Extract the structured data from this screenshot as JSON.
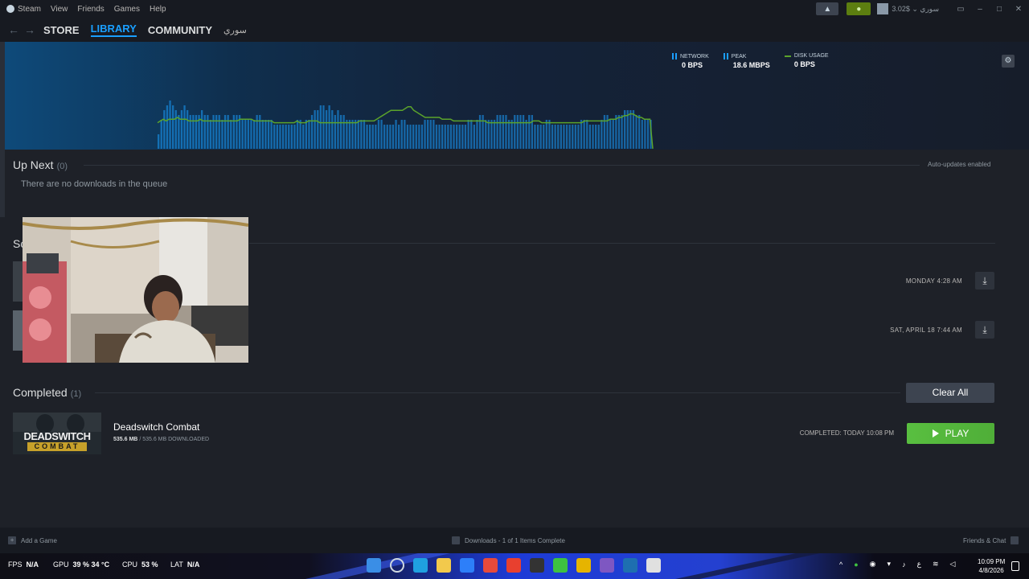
{
  "titlebar": {
    "menu": [
      "Steam",
      "View",
      "Friends",
      "Games",
      "Help"
    ],
    "account_name": "سوري",
    "balance": "$3.02"
  },
  "nav": {
    "store": "STORE",
    "library": "LIBRARY",
    "community": "COMMUNITY",
    "username": "سوري"
  },
  "graph": {
    "stats": [
      {
        "label": "NETWORK",
        "value": "0 bps"
      },
      {
        "label": "PEAK",
        "value": "18.6 Mbps"
      },
      {
        "label": "DISK USAGE",
        "value": "0 bps"
      }
    ],
    "network_bars": [
      3,
      6,
      8,
      9,
      10,
      9,
      8,
      7,
      8,
      9,
      8,
      7,
      7,
      7,
      7,
      8,
      7,
      7,
      6,
      7,
      7,
      7,
      6,
      7,
      7,
      6,
      7,
      7,
      7,
      6,
      6,
      6,
      6,
      6,
      7,
      7,
      6,
      6,
      6,
      6,
      5,
      5,
      5,
      5,
      5,
      5,
      5,
      5,
      6,
      6,
      5,
      6,
      6,
      7,
      8,
      8,
      9,
      9,
      8,
      9,
      8,
      7,
      8,
      7,
      7,
      6,
      6,
      6,
      6,
      6,
      6,
      6,
      5,
      5,
      5,
      5,
      6,
      6,
      5,
      5,
      5,
      5,
      6,
      5,
      6,
      6,
      5,
      5,
      5,
      5,
      5,
      5,
      6,
      6,
      6,
      6,
      5,
      5,
      5,
      5,
      5,
      5,
      5,
      5,
      5,
      5,
      5,
      6,
      6,
      5,
      6,
      7,
      7,
      6,
      6,
      6,
      6,
      7,
      7,
      7,
      7,
      6,
      6,
      7,
      7,
      7,
      7,
      6,
      7,
      7,
      5,
      5,
      5,
      5,
      6,
      6,
      5,
      5,
      5,
      5,
      5,
      5,
      5,
      5,
      5,
      5,
      6,
      6,
      6,
      5,
      5,
      5,
      5,
      6,
      7,
      7,
      6,
      6,
      7,
      7,
      7,
      8,
      8,
      8,
      8,
      7,
      7,
      6,
      6,
      6,
      6
    ],
    "disk_line": [
      2,
      3,
      4,
      3,
      4,
      4,
      4,
      5,
      4,
      4,
      4,
      3,
      3,
      3,
      3,
      4,
      3,
      3,
      3,
      3,
      3,
      3,
      3,
      3,
      3,
      3,
      3,
      3,
      3,
      4,
      4,
      4,
      4,
      4,
      3,
      3,
      3,
      3,
      3,
      3,
      3,
      2,
      2,
      2,
      2,
      2,
      2,
      2,
      2,
      3,
      2,
      2,
      2,
      3,
      3,
      3,
      3,
      2,
      2,
      2,
      2,
      2,
      2,
      2,
      2,
      2,
      2,
      2,
      2,
      2,
      2,
      3,
      3,
      3,
      3,
      3,
      3,
      4,
      5,
      6,
      7,
      8,
      9,
      9,
      9,
      9,
      9,
      10,
      11,
      11,
      9,
      8,
      7,
      6,
      5,
      5,
      5,
      5,
      5,
      5,
      4,
      4,
      4,
      4,
      3,
      3,
      3,
      3,
      3,
      3,
      3,
      3,
      3,
      3,
      3,
      3,
      2,
      2,
      2,
      2,
      2,
      2,
      2,
      2,
      2,
      2,
      2,
      2,
      2,
      2,
      2,
      2,
      3,
      3,
      3,
      2,
      2,
      2,
      2,
      2,
      2,
      2,
      2,
      2,
      2,
      2,
      2,
      2,
      2,
      2,
      3,
      3,
      3,
      3,
      3,
      3,
      3,
      3,
      3,
      4,
      4,
      4,
      5,
      5,
      6,
      6,
      7,
      7,
      6,
      5,
      5,
      4,
      4,
      4,
      0
    ],
    "colors": {
      "network": "#1a9fff",
      "disk": "#5ba32b"
    }
  },
  "up_next": {
    "title": "Up Next",
    "count": "(0)",
    "auto_updates": "Auto-updates enabled",
    "empty_text": "There are no downloads in the queue"
  },
  "scheduled": {
    "title_fragment": "Sc",
    "rows": [
      {
        "time": "MONDAY 4:28 AM"
      },
      {
        "time": "SAT, APRIL 18 7:44 AM"
      }
    ]
  },
  "completed": {
    "title": "Completed",
    "count": "(1)",
    "clear_all": "Clear All",
    "game": {
      "name": "Deadswitch Combat",
      "capsule_line1": "DEADSWITCH",
      "capsule_line2": "COMBAT",
      "size_done": "535.6 MB",
      "size_total": "/ 535.6 MB DOWNLOADED",
      "completed_text": "COMPLETED: TODAY 10:08 PM",
      "play_label": "PLAY"
    }
  },
  "footer": {
    "add_game": "Add a Game",
    "downloads_status": "Downloads - 1 of 1 Items Complete",
    "friends_chat": "Friends & Chat"
  },
  "taskbar": {
    "fps_label": "FPS",
    "fps_value": "N/A",
    "gpu_label": "GPU",
    "gpu_value": "39 % 34 °C",
    "cpu_label": "CPU",
    "cpu_value": "53 %",
    "lat_label": "LAT",
    "lat_value": "N/A",
    "lang": "ع",
    "time": "10:09 PM",
    "date": "4/8/2026",
    "icon_colors": [
      "#3a8ee6",
      "#cfd8e0",
      "#1fa0e0",
      "#f2c94c",
      "#2d7ff9",
      "#e64a3c",
      "#e8402f",
      "#333333",
      "#3ec241",
      "#e6b400",
      "#7e57c2",
      "#1e6fb0",
      "#e0e0e0"
    ]
  }
}
